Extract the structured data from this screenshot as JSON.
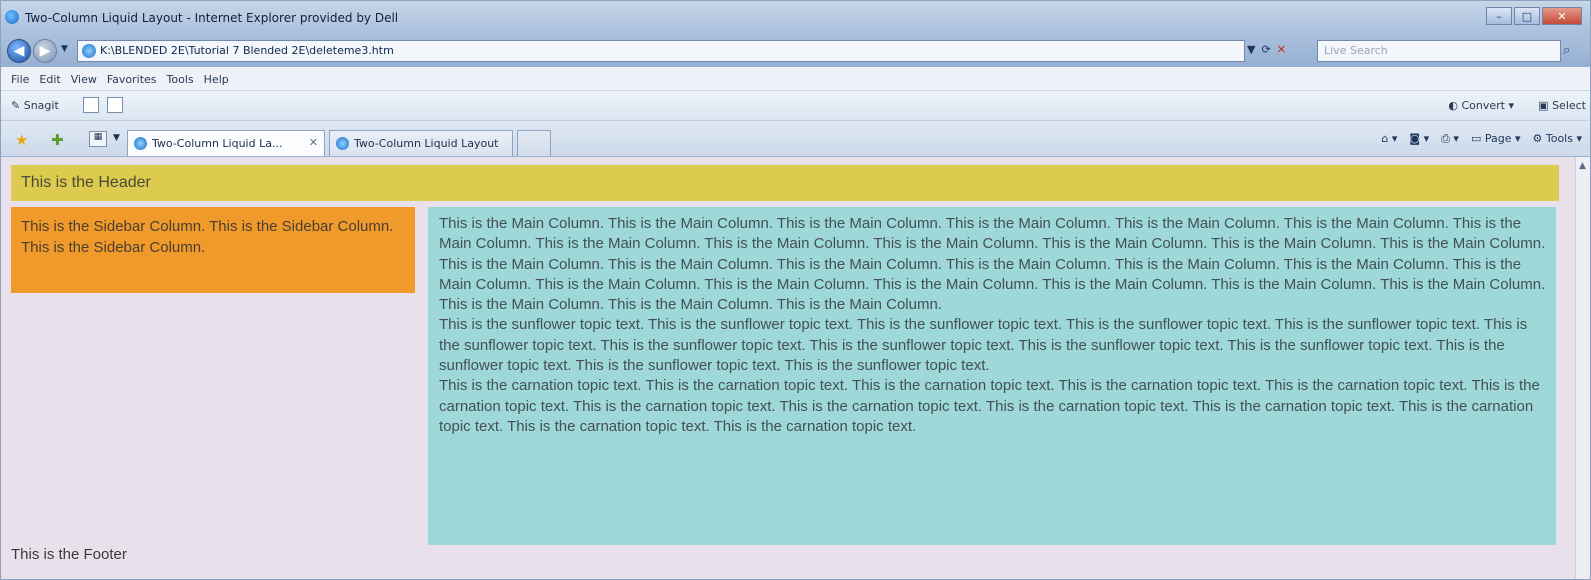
{
  "window": {
    "title": "Two-Column Liquid Layout - Internet Explorer provided by Dell",
    "controls": {
      "minimize": "–",
      "maximize": "□",
      "close": "✕"
    }
  },
  "navbar": {
    "address": "K:\\BLENDED 2E\\Tutorial 7 Blended 2E\\deleteme3.htm",
    "search_placeholder": "Live Search",
    "refresh_glyph": "⟳",
    "stop_glyph": "✕",
    "search_glyph": "⌕"
  },
  "menu": [
    "File",
    "Edit",
    "View",
    "Favorites",
    "Tools",
    "Help"
  ],
  "snagbar": {
    "snagit": "Snagit",
    "convert": "Convert",
    "select": "Select"
  },
  "tabs": [
    {
      "label": "Two-Column Liquid La...",
      "close": "✕"
    },
    {
      "label": "Two-Column Liquid Layout"
    }
  ],
  "tab_tools": {
    "page": "Page",
    "tools": "Tools"
  },
  "page": {
    "header": "This is the Header",
    "sidebar": "This is the Sidebar Column. This is the Sidebar Column. This is the Sidebar Column.",
    "main_text": "This is the Main Column. This is the Main Column. This is the Main Column. This is the Main Column. This is the Main Column. This is the Main Column. This is the Main Column. This is the Main Column. This is the Main Column. This is the Main Column. This is the Main Column. This is the Main Column. This is the Main Column. This is the Main Column. This is the Main Column. This is the Main Column. This is the Main Column. This is the Main Column. This is the Main Column. This is the Main Column. This is the Main Column. This is the Main Column. This is the Main Column. This is the Main Column. This is the Main Column. This is the Main Column. This is the Main Column. This is the Main Column. This is the Main Column.",
    "sunflower_text": "This is the sunflower topic text. This is the sunflower topic text. This is the sunflower topic text. This is the sunflower topic text. This is the sunflower topic text. This is the sunflower topic text. This is the sunflower topic text. This is the sunflower topic text. This is the sunflower topic text. This is the sunflower topic text. This is the sunflower topic text. This is the sunflower topic text. This is the sunflower topic text.",
    "carnation_text": "This is the carnation topic text. This is the carnation topic text. This is the carnation topic text. This is the carnation topic text. This is the carnation topic text. This is the carnation topic text. This is the carnation topic text. This is the carnation topic text. This is the carnation topic text. This is the carnation topic text. This is the carnation topic text. This is the carnation topic text. This is the carnation topic text.",
    "footer": "This is the Footer"
  },
  "colors": {
    "header_bg": "#dccb4e",
    "sidebar_bg": "#f19a2c",
    "main_bg": "#9ed8d8",
    "page_bg": "#e8e1ec"
  }
}
